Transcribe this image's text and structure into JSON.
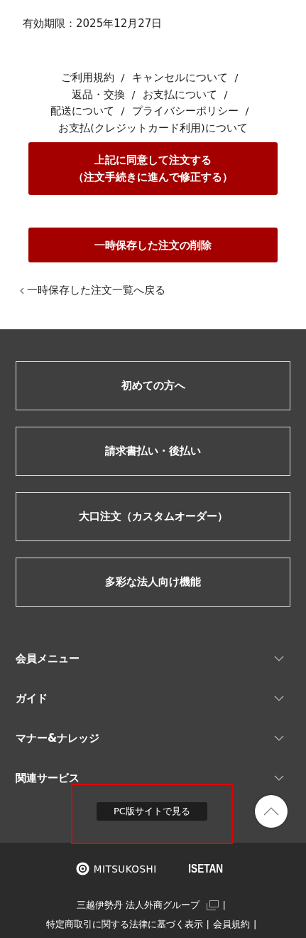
{
  "expiry": "有効期限：2025年12月27日",
  "policy_links": {
    "separator": "/",
    "lines": [
      [
        "ご利用規約",
        "キャンセルについて"
      ],
      [
        "返品・交換",
        "お支払について"
      ],
      [
        "配送について",
        "プライバシーポリシー"
      ],
      [
        "お支払(クレジットカード利用)について"
      ]
    ]
  },
  "primary_buttons": [
    {
      "lines": [
        "上記に同意して注文する",
        "（注文手続きに進んで修正する）"
      ]
    },
    {
      "lines": [
        "一時保存した注文の削除"
      ]
    }
  ],
  "back_link": "一時保存した注文一覧へ戻る",
  "nav_boxes": [
    "初めての方へ",
    "請求書払い・後払い",
    "大口注文（カスタムオーダー）",
    "多彩な法人向け機能"
  ],
  "accordion": [
    {
      "label": "会員メニュー",
      "expanded": false
    },
    {
      "label": "ガイド",
      "expanded": false
    },
    {
      "label": "マナー&ナレッジ",
      "expanded": false
    },
    {
      "label": "関連サービス",
      "expanded": false
    }
  ],
  "pc_site_button": {
    "label": "PC版サイトで見る",
    "highlighted": true
  },
  "logos": [
    {
      "kind": "emblem",
      "text": "MITSUKOSHI"
    },
    {
      "kind": "plain",
      "text": "ISETAN"
    }
  ],
  "footer_links": {
    "separator": "|",
    "lines": [
      [
        {
          "label": "三越伊勢丹 法人外商グループ",
          "external": true
        }
      ],
      [
        {
          "label": "特定商取引に関する法律に基づく表示",
          "external": false
        },
        {
          "label": "会員規約",
          "external": false
        }
      ]
    ]
  }
}
